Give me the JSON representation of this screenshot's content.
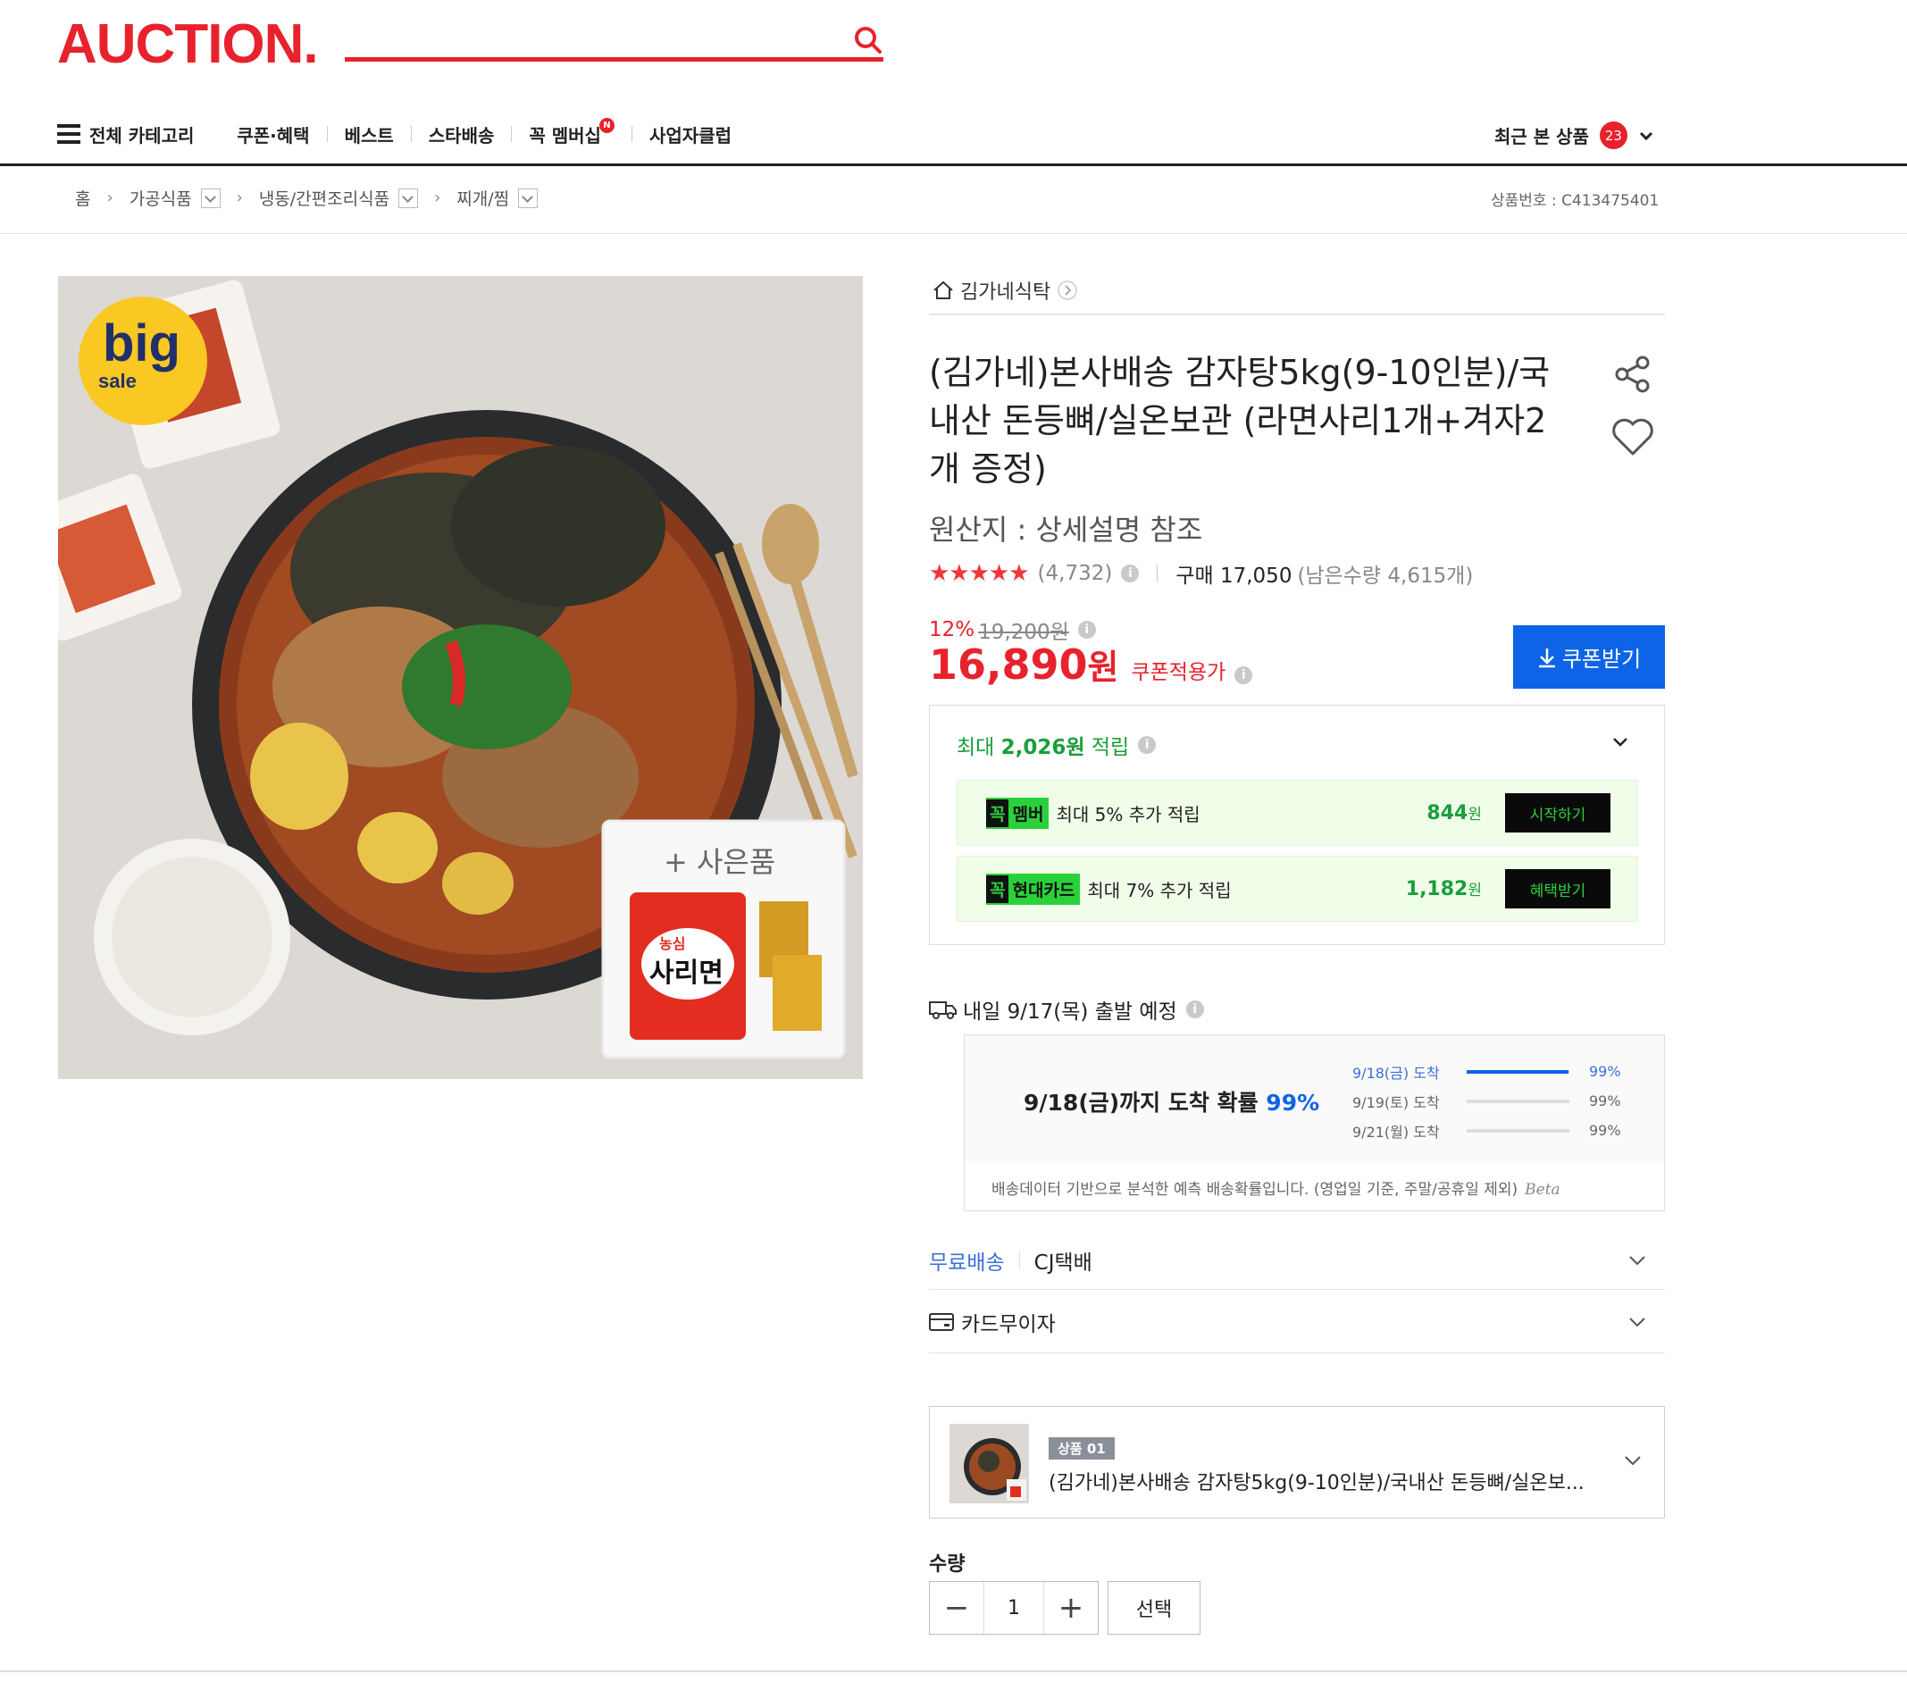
{
  "header": {
    "logo": "AUCTION.",
    "nav": [
      {
        "label": "전체 카테고리"
      },
      {
        "label": "쿠폰·혜택"
      },
      {
        "label": "베스트"
      },
      {
        "label": "스타배송"
      },
      {
        "label": "꼭 멤버십",
        "badge": "N"
      },
      {
        "label": "사업자클럽"
      }
    ],
    "recent_label": "최근 본 상품",
    "recent_count": "23"
  },
  "breadcrumb": {
    "home": "홈",
    "items": [
      "가공식품",
      "냉동/간편조리식품",
      "찌개/찜"
    ],
    "product_no": "상품번호 : C413475401"
  },
  "product_image": {
    "badge_top": "big",
    "badge_bottom": "sale",
    "gift_label": "+ 사은품",
    "gift_brand": "농심",
    "gift_name": "사리면"
  },
  "seller": "김가네식탁",
  "title": "(김가네)본사배송 감자탕5kg(9-10인분)/국내산 돈등뼈/실온보관 (라면사리1개+겨자2개 증정)",
  "origin": "원산지 : 상세설명 참조",
  "rating": {
    "stars": "★★★★★",
    "review_count": "(4,732)",
    "buy_label": "구매 17,050",
    "remaining": "(남은수량 4,615개)"
  },
  "price": {
    "discount_rate": "12%",
    "original": "19,200원",
    "final_num": "16,890",
    "final_unit": "원",
    "coupon_label": "쿠폰적용가",
    "coupon_button": "쿠폰받기"
  },
  "rewards": {
    "head_prefix": "최대",
    "head_amount": "2,026원",
    "head_suffix": "적립",
    "rows": [
      {
        "tag_k": "꼭",
        "tag": "멤버",
        "desc": "최대 5% 추가 적립",
        "amount": "844",
        "unit": "원",
        "button": "시작하기"
      },
      {
        "tag_k": "꼭",
        "tag": "현대카드",
        "desc": "최대 7% 추가 적립",
        "amount": "1,182",
        "unit": "원",
        "button": "혜택받기"
      }
    ]
  },
  "shipping": {
    "depart": "내일 9/17(목) 출발 예정",
    "prob_main": "9/18(금)까지 도착 확률",
    "prob_pct": "99%",
    "rows": [
      {
        "date": "9/18(금) 도착",
        "pct": "99%",
        "fill": 0.99
      },
      {
        "date": "9/19(토) 도착",
        "pct": "99%",
        "fill": 0
      },
      {
        "date": "9/21(월) 도착",
        "pct": "99%",
        "fill": 0
      }
    ],
    "note": "배송데이터 기반으로 분석한 예측 배송확률입니다. (영업일 기준, 주말/공휴일 제외)",
    "beta": "Beta"
  },
  "delivery": {
    "free": "무료배송",
    "carrier": "CJ택배"
  },
  "card": {
    "label": "카드무이자"
  },
  "option": {
    "tag": "상품 01",
    "name": "(김가네)본사배송 감자탕5kg(9-10인분)/국내산 돈등뼈/실온보..."
  },
  "quantity": {
    "label": "수량",
    "minus": "−",
    "value": "1",
    "plus": "+",
    "select": "선택"
  },
  "colors": {
    "brand": "#e8222c",
    "blue": "#0e64e6",
    "green": "#1a9e3a",
    "neon": "#2ad13b"
  }
}
